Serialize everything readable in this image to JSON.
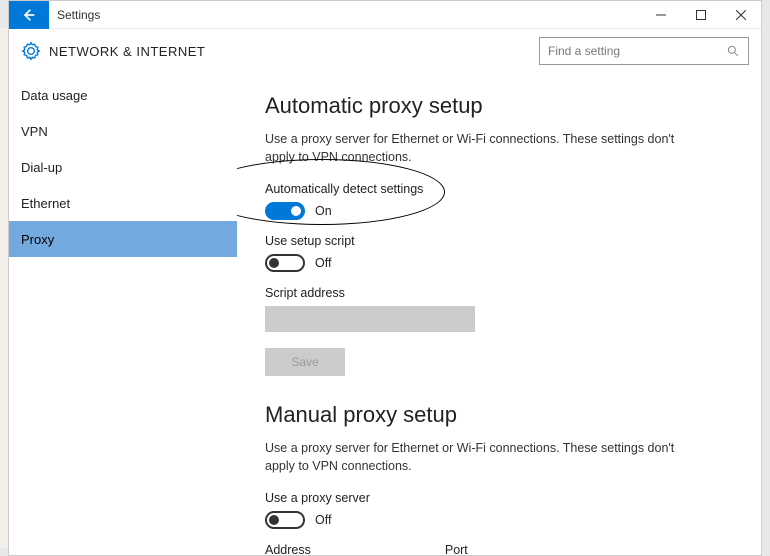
{
  "titlebar": {
    "title": "Settings"
  },
  "header": {
    "section": "NETWORK & INTERNET",
    "search_placeholder": "Find a setting"
  },
  "sidebar": {
    "items": [
      {
        "label": "Data usage"
      },
      {
        "label": "VPN"
      },
      {
        "label": "Dial-up"
      },
      {
        "label": "Ethernet"
      },
      {
        "label": "Proxy"
      }
    ],
    "selected_index": 4
  },
  "content": {
    "auto": {
      "heading": "Automatic proxy setup",
      "desc": "Use a proxy server for Ethernet or Wi-Fi connections. These settings don't apply to VPN connections.",
      "detect_label": "Automatically detect settings",
      "detect_state": "On",
      "script_toggle_label": "Use setup script",
      "script_state": "Off",
      "script_addr_label": "Script address",
      "save_label": "Save"
    },
    "manual": {
      "heading": "Manual proxy setup",
      "desc": "Use a proxy server for Ethernet or Wi-Fi connections. These settings don't apply to VPN connections.",
      "use_label": "Use a proxy server",
      "use_state": "Off",
      "address_label": "Address",
      "port_label": "Port"
    }
  }
}
